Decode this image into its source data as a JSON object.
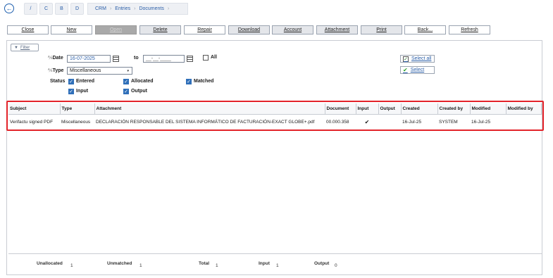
{
  "header": {
    "letters": [
      "/",
      "C",
      "B",
      "D"
    ],
    "breadcrumbs": [
      "CRM",
      "Entries",
      "Documents"
    ]
  },
  "toolbar": {
    "buttons": [
      "Close",
      "New",
      "Open",
      "Delete",
      "Repair",
      "Download",
      "Account",
      "Attachment",
      "Print",
      "Back...",
      "Refresh"
    ]
  },
  "filter": {
    "filter_label": "Filter",
    "date_label": "Date",
    "date_from": "16-07-2025",
    "to_label": "to",
    "date_to": "__-__-____",
    "all_label": "All",
    "type_label": "Type",
    "type_value": "Miscellaneous",
    "status_label": "Status",
    "status_options": [
      {
        "label": "Entered",
        "checked": true
      },
      {
        "label": "Allocated",
        "checked": true
      },
      {
        "label": "Matched",
        "checked": true
      },
      {
        "label": "Input",
        "checked": true
      },
      {
        "label": "Output",
        "checked": true
      }
    ],
    "select_all_label": "Select all",
    "select_label": "Select"
  },
  "table": {
    "columns": [
      "Subject",
      "Type",
      "Attachment",
      "Document",
      "Input",
      "Output",
      "Created",
      "Created by",
      "Modified",
      "Modified by"
    ],
    "rows": [
      [
        "Verifactu signed PDF",
        "Miscellaneous",
        "DECLARACIÓN RESPONSABLE DEL SISTEMA INFORMÁTICO DE FACTURACIÓN-EXACT GLOBE+.pdf",
        "00.000.358",
        "✔",
        "",
        "16-Jul-25",
        "SYSTEM",
        "16-Jul-25",
        ""
      ]
    ]
  },
  "footer": {
    "unallocated_label": "Unallocated",
    "unallocated_value": "1",
    "unmatched_label": "Unmatched",
    "unmatched_value": "1",
    "total_label": "Total",
    "total_value": "1",
    "input_label": "Input",
    "input_value": "1",
    "output_label": "Output",
    "output_value": "0"
  },
  "colors": {
    "accent": "#2a5ea8",
    "highlight": "#e3232a",
    "disabled": "#a9a9a9"
  }
}
